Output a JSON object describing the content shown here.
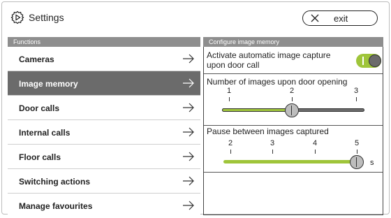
{
  "header": {
    "title": "Settings",
    "title_icon": "gear-icon",
    "exit_label": "exit",
    "exit_icon": "close-icon"
  },
  "left": {
    "section_label": "Functions",
    "items": [
      {
        "label": "Cameras",
        "active": false
      },
      {
        "label": "Image memory",
        "active": true
      },
      {
        "label": "Door calls",
        "active": false
      },
      {
        "label": "Internal calls",
        "active": false
      },
      {
        "label": "Floor calls",
        "active": false
      },
      {
        "label": "Switching actions",
        "active": false
      },
      {
        "label": "Manage favourites",
        "active": false
      }
    ]
  },
  "right": {
    "section_label": "Configure image memory",
    "auto_capture": {
      "label_line1": "Activate automatic image capture",
      "label_line2": "upon door call",
      "enabled": true
    },
    "images_count": {
      "label": "Number of images upon door opening",
      "ticks": [
        "1",
        "2",
        "3"
      ],
      "value": 2
    },
    "pause": {
      "label": "Pause between images captured",
      "ticks": [
        "2",
        "3",
        "4",
        "5"
      ],
      "value": 5,
      "unit": "s"
    }
  },
  "colors": {
    "accent_green": "#9fc53a",
    "track_gray": "#6b6b6b",
    "active_item_bg": "#6b6b6b",
    "section_header_bg": "#8e8e8e"
  }
}
